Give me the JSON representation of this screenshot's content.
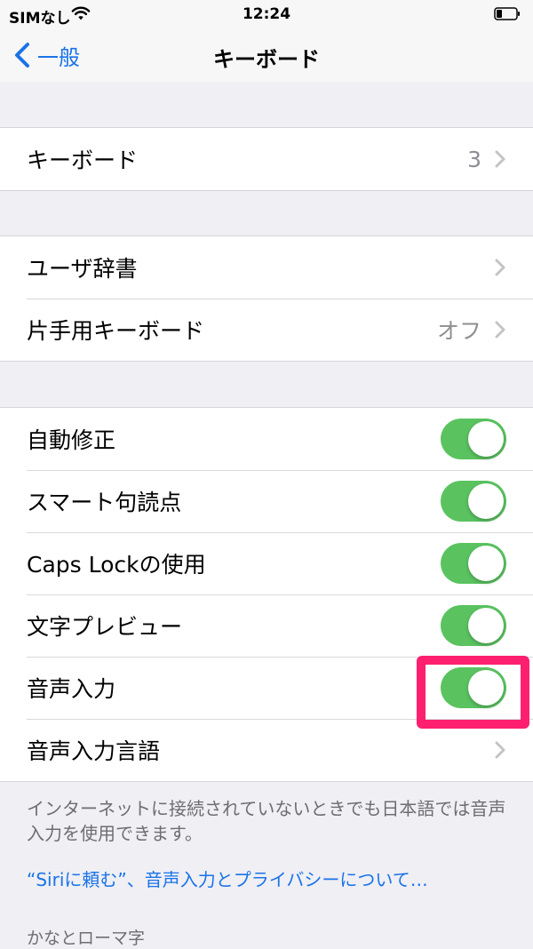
{
  "status_bar": {
    "carrier": "SIMなし",
    "time": "12:24"
  },
  "nav": {
    "back_label": "一般",
    "title": "キーボード"
  },
  "groups": [
    {
      "rows": [
        {
          "label": "キーボード",
          "value": "3",
          "accessory": "chevron"
        }
      ]
    },
    {
      "rows": [
        {
          "label": "ユーザ辞書",
          "value": "",
          "accessory": "chevron"
        },
        {
          "label": "片手用キーボード",
          "value": "オフ",
          "accessory": "chevron"
        }
      ]
    },
    {
      "rows": [
        {
          "label": "自動修正",
          "accessory": "toggle",
          "on": true
        },
        {
          "label": "スマート句読点",
          "accessory": "toggle",
          "on": true
        },
        {
          "label": "Caps Lockの使用",
          "accessory": "toggle",
          "on": true
        },
        {
          "label": "文字プレビュー",
          "accessory": "toggle",
          "on": true
        },
        {
          "label": "音声入力",
          "accessory": "toggle",
          "on": true
        },
        {
          "label": "音声入力言語",
          "value": "",
          "accessory": "chevron"
        }
      ]
    }
  ],
  "footnote": "インターネットに接続されていないときでも日本語では音声入力を使用できます。",
  "about_link": "“Siriに頼む”、音声入力とプライバシーについて…",
  "section_header": "かなとローマ字",
  "colors": {
    "accent": "#1a73e8",
    "toggle_on": "#5ac360",
    "highlight": "#ff1f6f",
    "background": "#efeff4"
  }
}
